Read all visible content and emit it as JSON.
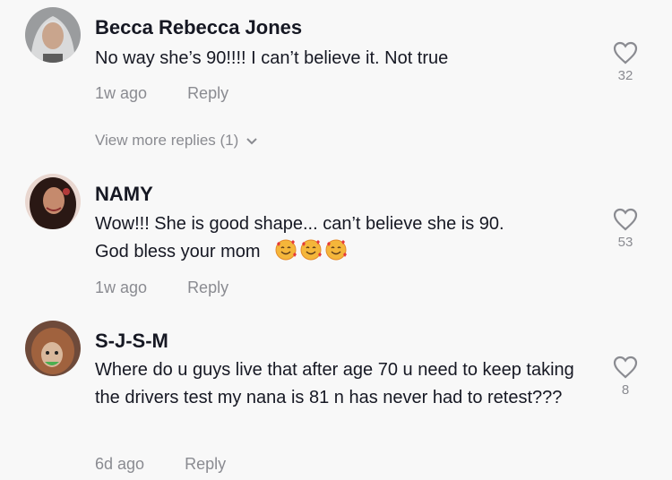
{
  "comments": [
    {
      "author": "Becca Rebecca Jones",
      "text": "No way she’s 90!!!! I can’t believe it. Not true",
      "time": "1w ago",
      "reply_label": "Reply",
      "likes": "32",
      "view_more": "View more replies (1)"
    },
    {
      "author": "NAMY",
      "text_line1": "Wow!!! She is good shape... can’t believe she is 90.",
      "text_line2": "God bless your mom",
      "emojis": [
        "smiling-face-with-hearts",
        "smiling-face-with-hearts",
        "smiling-face-with-hearts"
      ],
      "time": "1w ago",
      "reply_label": "Reply",
      "likes": "53"
    },
    {
      "author": "S-J-S-M",
      "text": "Where do u guys live that after age 70 u need to keep taking the drivers test my nana is 81 n has never had to retest???",
      "time": "6d ago",
      "reply_label": "Reply",
      "likes": "8"
    }
  ],
  "colors": {
    "text": "#161823",
    "muted": "#8a8b91",
    "background": "#f8f8f8"
  }
}
